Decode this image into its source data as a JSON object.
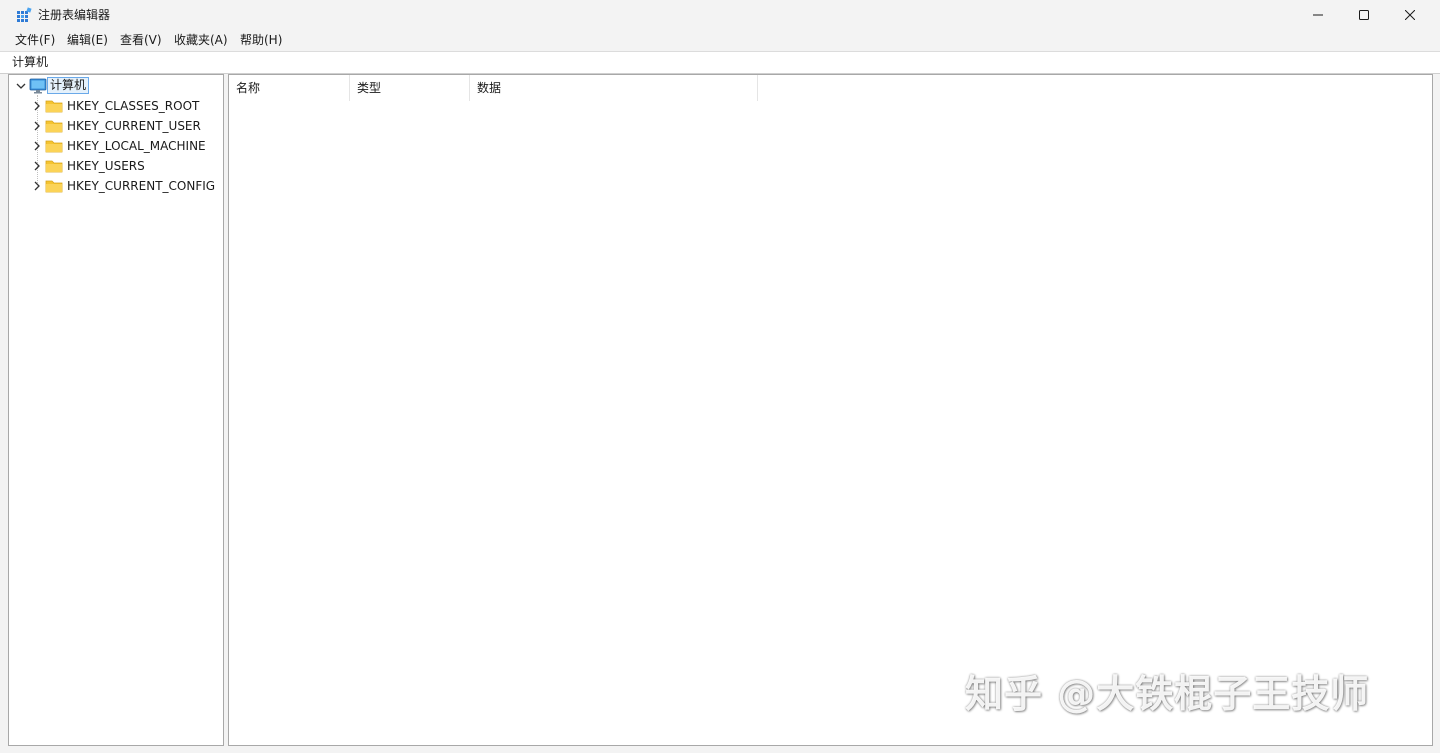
{
  "window": {
    "title": "注册表编辑器"
  },
  "menu": {
    "items": [
      {
        "label": "文件(F)"
      },
      {
        "label": "编辑(E)"
      },
      {
        "label": "查看(V)"
      },
      {
        "label": "收藏夹(A)"
      },
      {
        "label": "帮助(H)"
      }
    ]
  },
  "address": {
    "path": "计算机"
  },
  "tree": {
    "root": {
      "label": "计算机",
      "icon": "computer-icon",
      "expanded": true
    },
    "keys": [
      {
        "label": "HKEY_CLASSES_ROOT",
        "icon": "folder-icon"
      },
      {
        "label": "HKEY_CURRENT_USER",
        "icon": "folder-icon"
      },
      {
        "label": "HKEY_LOCAL_MACHINE",
        "icon": "folder-icon"
      },
      {
        "label": "HKEY_USERS",
        "icon": "folder-icon"
      },
      {
        "label": "HKEY_CURRENT_CONFIG",
        "icon": "folder-icon"
      }
    ]
  },
  "list": {
    "columns": [
      {
        "label": "名称"
      },
      {
        "label": "类型"
      },
      {
        "label": "数据"
      }
    ]
  },
  "watermark": {
    "text": "知乎 @大铁棍子王技师"
  },
  "colors": {
    "folder": "#f5c431",
    "selection_border": "#6aa9e9",
    "selection_bg": "#e5f1fb",
    "window_bg": "#f3f3f3"
  }
}
